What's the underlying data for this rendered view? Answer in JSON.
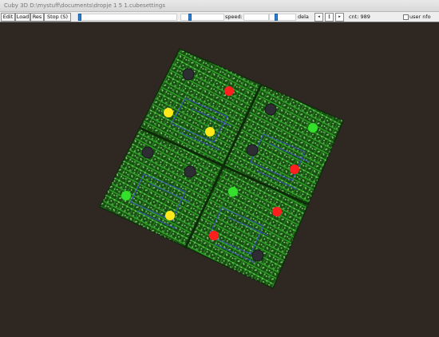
{
  "window": {
    "title": "Cuby 3D D:\\mystuff\\documents\\dropje 1 5 1.cubesettings"
  },
  "toolbar": {
    "edit_label": "Edit",
    "load_label": "Load",
    "reset_label": "Res",
    "stop_label": "Stop (S)",
    "speed_label": "speed:",
    "delay_label": "dela",
    "count_label": "cnt: 989",
    "user_label": "user nfo",
    "sliders": [
      {
        "name": "slider-1",
        "value": 0.0
      },
      {
        "name": "slider-2",
        "value": 0.19
      },
      {
        "name": "slider-3",
        "value": 0.0
      },
      {
        "name": "slider-4",
        "value": 0.22
      }
    ],
    "spin_buttons": [
      "◂",
      "‖",
      "▸"
    ]
  },
  "scene": {
    "background": "#2f2822",
    "board_color": "#184f12",
    "trace_color": "#35c22a",
    "dark_node_color": "#2d2d33",
    "led_colors": {
      "red": "#ff1f1f",
      "yellow": "#ffe81a",
      "green": "#33e02a"
    }
  }
}
